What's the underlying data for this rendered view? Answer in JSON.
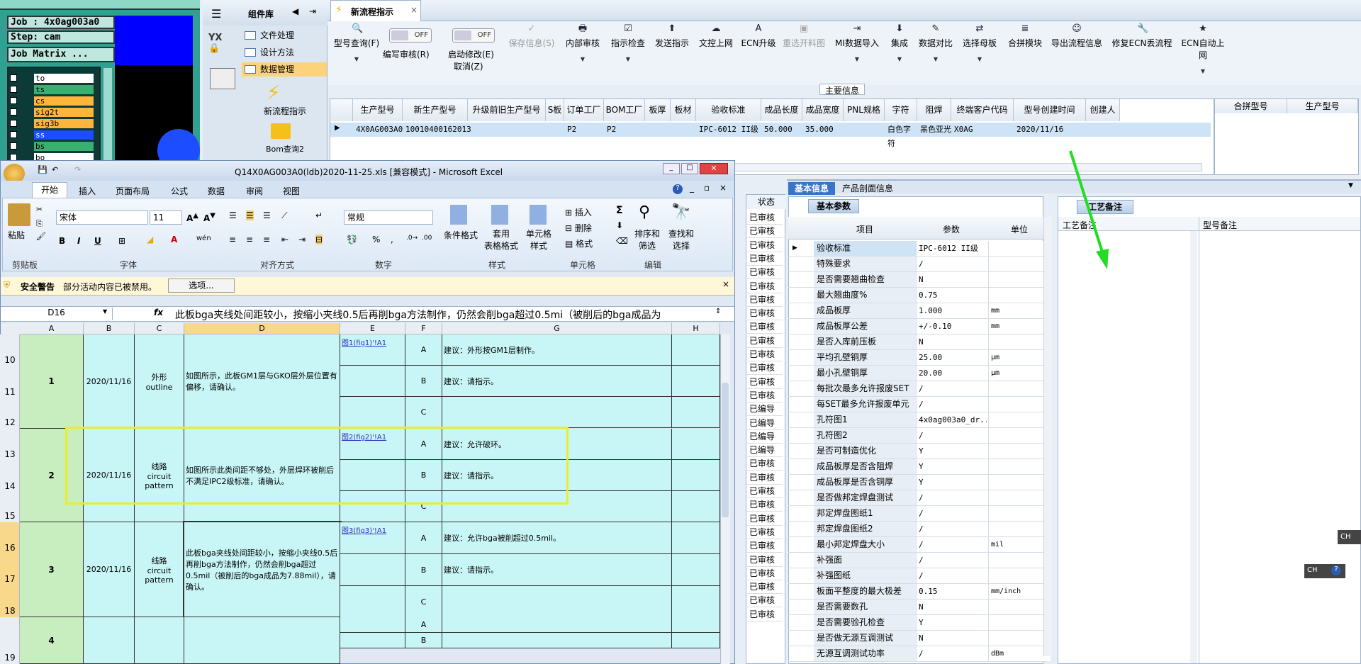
{
  "cam": {
    "job": "Job : 4x0ag003a0",
    "step": "Step: cam",
    "matrix": "Job Matrix ...",
    "layers": [
      "to",
      "ts",
      "cs",
      "sig2t",
      "sig3b",
      "ss",
      "bs",
      "bo"
    ]
  },
  "component_panel": {
    "title": "组件库",
    "items": [
      "文件处理",
      "设计方法",
      "数据管理"
    ],
    "tool1": "新流程指示",
    "tool2": "Bom查询2"
  },
  "app": {
    "tab": "新流程指示",
    "toolbar": [
      {
        "label": "型号查询(F)",
        "icon": "🔍"
      },
      {
        "label": "编写审核(R)",
        "icon": "",
        "toggle": "OFF"
      },
      {
        "label": "启动修改(E)",
        "icon": "",
        "toggle": "OFF",
        "sub": "取消(Z)"
      },
      {
        "label": "保存信息(S)",
        "icon": "✓"
      },
      {
        "label": "内部审核",
        "icon": "🖶"
      },
      {
        "label": "指示检查",
        "icon": "☑"
      },
      {
        "label": "发送指示",
        "icon": "⬆"
      },
      {
        "label": "文控上网",
        "icon": "☁"
      },
      {
        "label": "ECN升级",
        "icon": "A"
      },
      {
        "label": "重选开料图",
        "icon": "▣"
      },
      {
        "label": "MI数据导入",
        "icon": "⇥"
      },
      {
        "label": "集成",
        "icon": "⬇"
      },
      {
        "label": "数据对比",
        "icon": "✎"
      },
      {
        "label": "选择母板",
        "icon": "⇄"
      },
      {
        "label": "合拼模块",
        "icon": "≣"
      },
      {
        "label": "导出流程信息",
        "icon": "☺"
      },
      {
        "label": "修复ECN丢流程",
        "icon": "🔧"
      },
      {
        "label": "ECN自动上网",
        "icon": "★"
      }
    ],
    "main_info_label": "主要信息",
    "grid_headers": [
      "生产型号",
      "新生产型号",
      "升级前旧生产型号",
      "S板",
      "订单工厂",
      "BOM工厂",
      "板厚",
      "板材",
      "验收标准",
      "成品长度",
      "成品宽度",
      "PNL规格",
      "字符",
      "阻焊",
      "终端客户代码",
      "型号创建时间",
      "创建人"
    ],
    "grid_row": [
      "4X0AG003A0",
      "10010400162013",
      "",
      "",
      "P2",
      "P2",
      "",
      "",
      "IPC-6012 II级",
      "50.000",
      "35.000",
      "",
      "白色字符",
      "黑色亚光",
      "X0AG",
      "2020/11/16",
      ""
    ],
    "side_headers": [
      "合拼型号",
      "生产型号"
    ],
    "tabs": [
      "基本信息",
      "产品剖面信息"
    ],
    "subtab": "基本参数",
    "param_headers": [
      "项目",
      "参数",
      "单位"
    ],
    "params": [
      [
        "验收标准",
        "IPC-6012 II级",
        ""
      ],
      [
        "特殊要求",
        "/",
        ""
      ],
      [
        "是否需要翘曲检查",
        "N",
        ""
      ],
      [
        "最大翘曲度%",
        "0.75",
        ""
      ],
      [
        "成品板厚",
        "1.000",
        "mm"
      ],
      [
        "成品板厚公差",
        "+/-0.10",
        "mm"
      ],
      [
        "是否入库前压板",
        "N",
        ""
      ],
      [
        "平均孔壁铜厚",
        "25.00",
        "μm"
      ],
      [
        "最小孔壁铜厚",
        "20.00",
        "μm"
      ],
      [
        "每批次最多允许报废SET",
        "/",
        ""
      ],
      [
        "每SET最多允许报废单元",
        "/",
        ""
      ],
      [
        "孔符图1",
        "4x0ag003a0_dr...",
        ""
      ],
      [
        "孔符图2",
        "/",
        ""
      ],
      [
        "是否可制造优化",
        "Y",
        ""
      ],
      [
        "成品板厚是否含阻焊",
        "Y",
        ""
      ],
      [
        "成品板厚是否含铜厚",
        "Y",
        ""
      ],
      [
        "是否做邦定焊盘测试",
        "/",
        ""
      ],
      [
        "邦定焊盘图纸1",
        "/",
        ""
      ],
      [
        "邦定焊盘图纸2",
        "/",
        ""
      ],
      [
        "最小邦定焊盘大小",
        "/",
        "mil"
      ],
      [
        "补强面",
        "/",
        ""
      ],
      [
        "补强图纸",
        "/",
        ""
      ],
      [
        "板面平整度的最大极差",
        "0.15",
        "mm/inch"
      ],
      [
        "是否需要数孔",
        "N",
        ""
      ],
      [
        "是否需要验孔检查",
        "Y",
        ""
      ],
      [
        "是否做无源互调测试",
        "N",
        ""
      ],
      [
        "无源互调测试功率",
        "/",
        "dBm"
      ]
    ],
    "status_header": "状态",
    "status_items": [
      "已审核",
      "已审核",
      "已审核",
      "已审核",
      "已审核",
      "已审核",
      "已审核",
      "已审核",
      "已审核",
      "已审核",
      "已审核",
      "已审核",
      "已审核",
      "已审核",
      "已编导",
      "已编导",
      "已编导",
      "已编导",
      "已审核",
      "已审核",
      "已审核",
      "已审核",
      "已审核",
      "已审核",
      "已审核",
      "已审核",
      "已审核",
      "已审核",
      "已审核",
      "已审核"
    ],
    "remark_tab": "工艺备注",
    "remark_headers": [
      "工艺备注",
      "型号备注"
    ],
    "ime": "CH"
  },
  "excel": {
    "title": "Q14X0AG003A0(ldb)2020-11-25.xls [兼容模式] - Microsoft Excel",
    "ribbon_tabs": [
      "开始",
      "插入",
      "页面布局",
      "公式",
      "数据",
      "审阅",
      "视图"
    ],
    "font_name": "宋体",
    "font_size": "11",
    "number_format": "常规",
    "paste": "粘贴",
    "groups": [
      "剪贴板",
      "字体",
      "对齐方式",
      "数字",
      "样式",
      "单元格",
      "编辑"
    ],
    "style_btns": [
      "条件格式",
      "套用\n表格格式",
      "单元格\n样式"
    ],
    "cell_btns": [
      "插入",
      "删除",
      "格式"
    ],
    "edit_btns": [
      "排序和\n筛选",
      "查找和\n选择"
    ],
    "security_title": "安全警告",
    "security_msg": "部分活动内容已被禁用。",
    "security_btn": "选项...",
    "name_box": "D16",
    "formula": "此板bga夹线处间距较小，按缩小夹线0.5后再削bga方法制作，仍然会削bga超过0.5mi（被削后的bga成品为",
    "columns": [
      "A",
      "B",
      "C",
      "D",
      "E",
      "F",
      "G",
      "H"
    ],
    "rows": [
      "10",
      "11",
      "12",
      "13",
      "14",
      "15",
      "16",
      "17",
      "18",
      "19"
    ],
    "records": [
      {
        "no": "1",
        "date": "2020/11/16",
        "cat": "外形\noutline",
        "desc": "如图所示，此板GM1层与GKO层外层位置有偏移，请确认。",
        "link": "图1(fig1)'!A1",
        "opts": [
          [
            "A",
            "建议：外形按GM1层制作。"
          ],
          [
            "B",
            "建议：请指示。"
          ],
          [
            "C",
            ""
          ]
        ]
      },
      {
        "no": "2",
        "date": "2020/11/16",
        "cat": "线路\ncircuit\npattern",
        "desc": "如图所示此类间距不够处，外层焊环被削后不满足IPC2级标准，请确认。",
        "link": "图2(fig2)'!A1",
        "opts": [
          [
            "A",
            "建议：允许破环。"
          ],
          [
            "B",
            "建议：请指示。"
          ],
          [
            "C",
            ""
          ]
        ]
      },
      {
        "no": "3",
        "date": "2020/11/16",
        "cat": "线路\ncircuit\npattern",
        "desc": "此板bga夹线处间距较小，按缩小夹线0.5后再削bga方法制作，仍然会削bga超过0.5mil（被削后的bga成品为7.88mil），请确认。",
        "link": "图3(fig3)'!A1",
        "opts": [
          [
            "A",
            "建议：允许bga被削超过0.5mil。"
          ],
          [
            "B",
            "建议：请指示。"
          ],
          [
            "C",
            ""
          ]
        ]
      },
      {
        "no": "4",
        "date": "",
        "cat": "",
        "desc": "",
        "link": "",
        "opts": [
          [
            "A",
            ""
          ],
          [
            "B",
            ""
          ]
        ]
      }
    ]
  }
}
